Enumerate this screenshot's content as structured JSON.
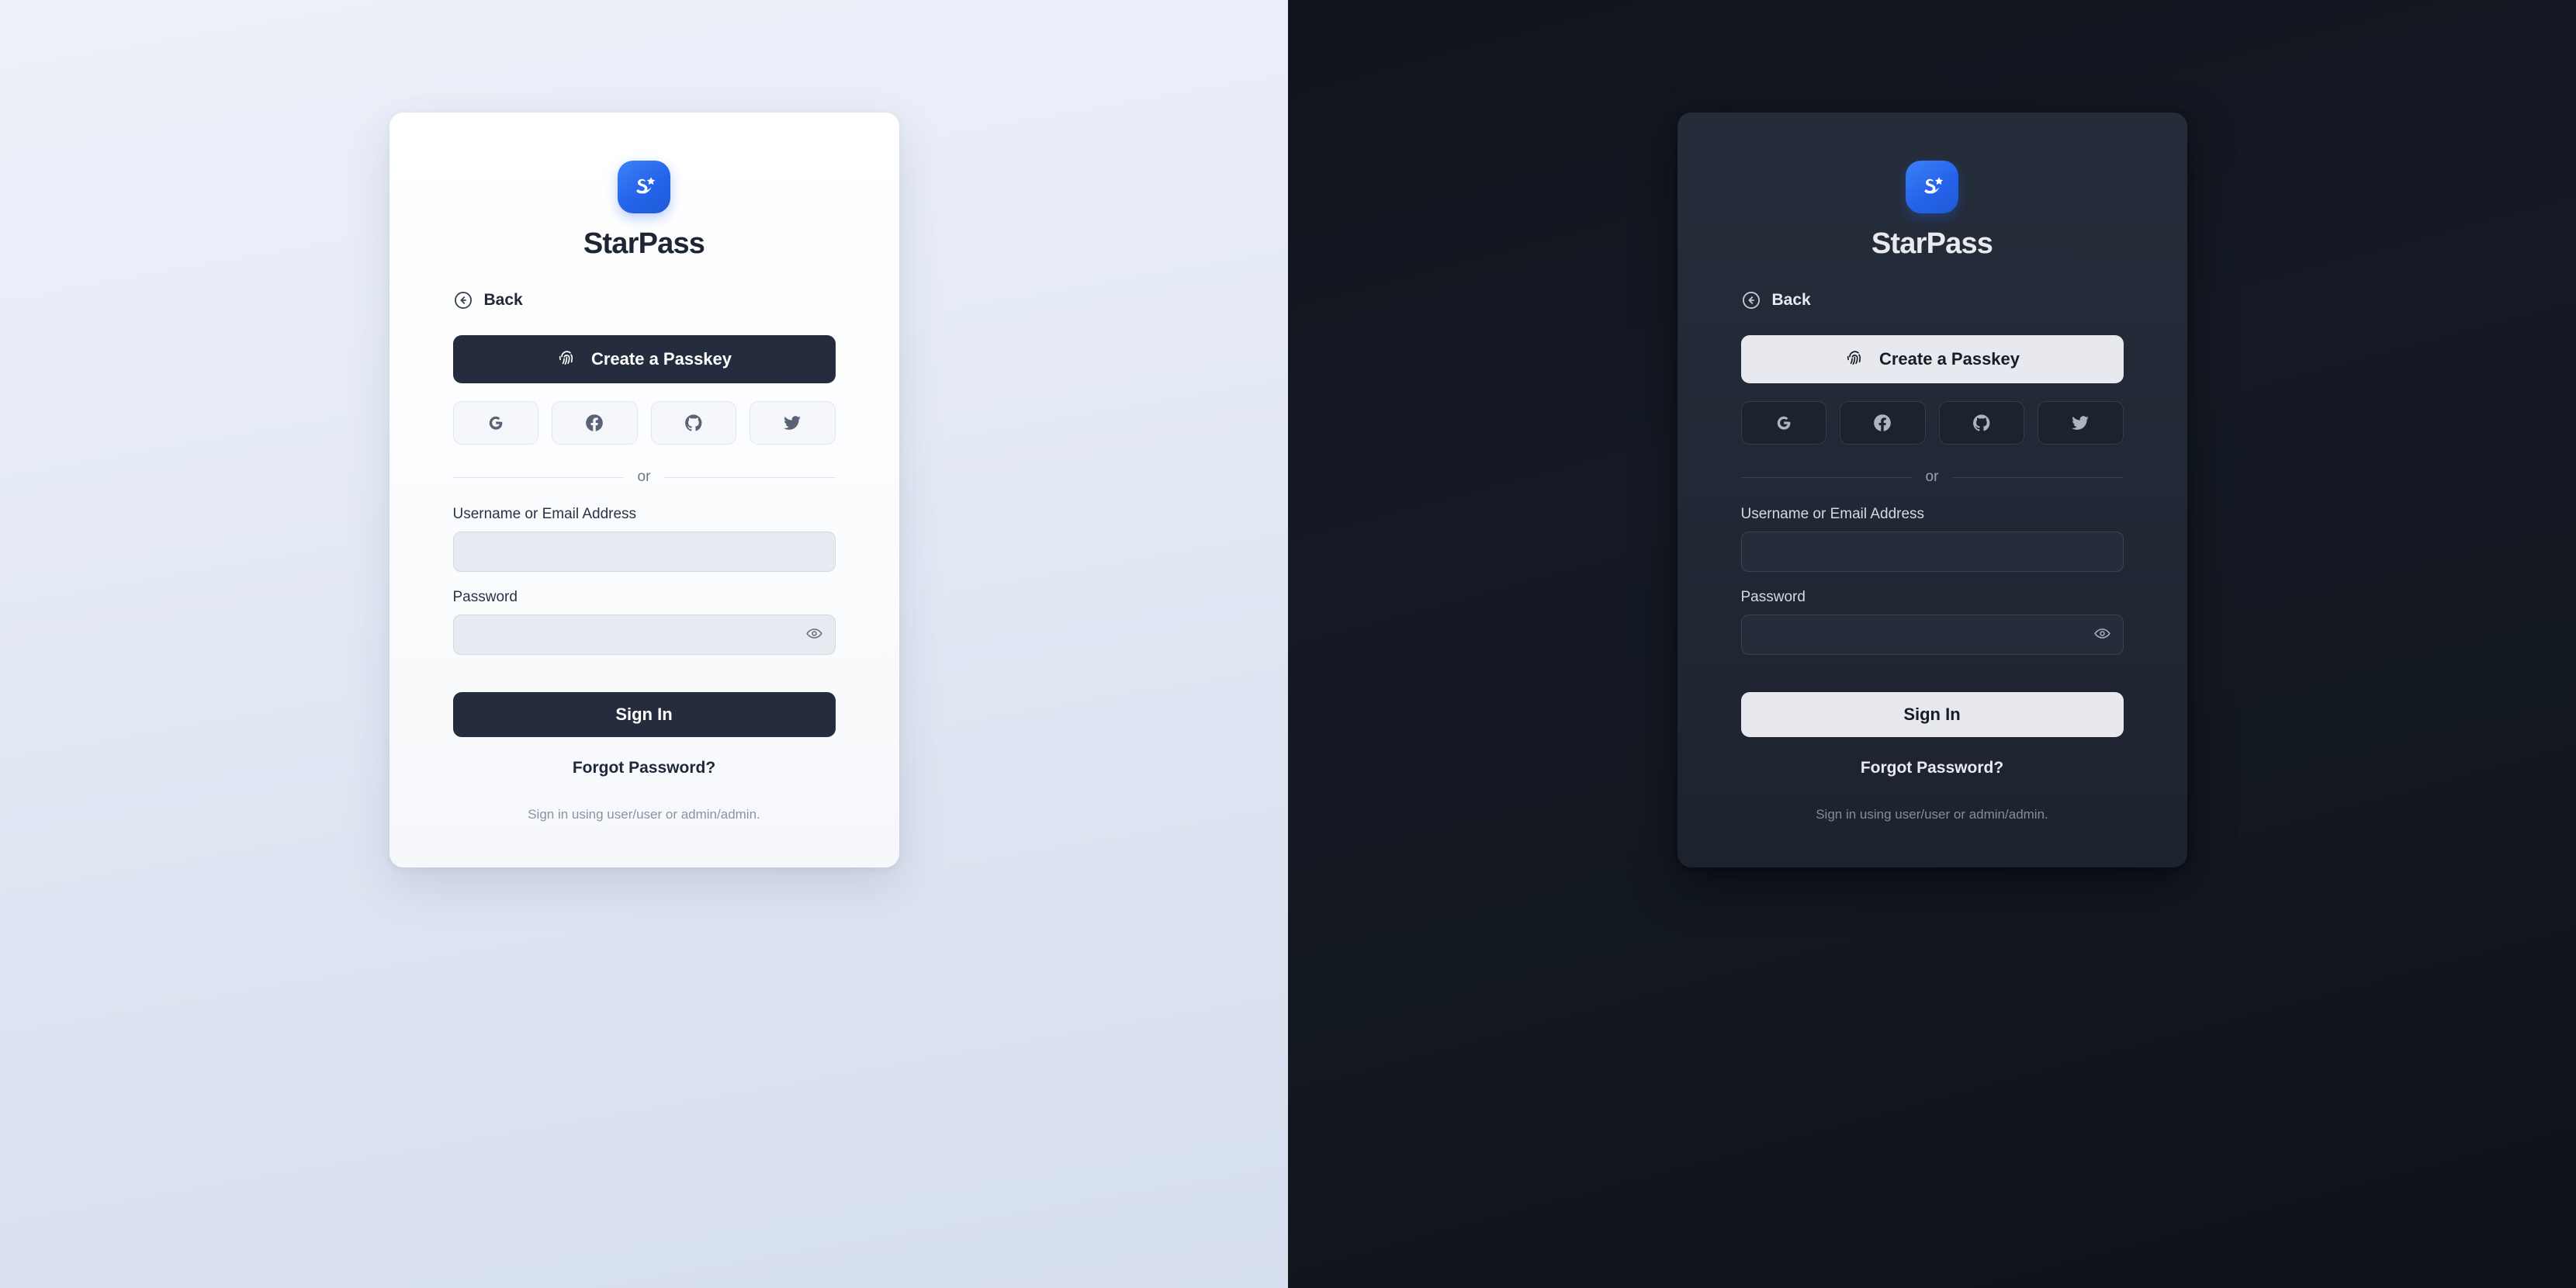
{
  "brand": {
    "name": "StarPass",
    "logo_icon": "starpass-logo-icon",
    "logo_color": "#2563eb"
  },
  "back": {
    "label": "Back",
    "icon": "arrow-left-circle-icon"
  },
  "passkey": {
    "label": "Create a Passkey",
    "icon": "fingerprint-icon"
  },
  "social": [
    {
      "name": "google",
      "icon": "google-icon"
    },
    {
      "name": "facebook",
      "icon": "facebook-icon"
    },
    {
      "name": "github",
      "icon": "github-icon"
    },
    {
      "name": "twitter",
      "icon": "twitter-icon"
    }
  ],
  "divider": {
    "label": "or"
  },
  "form": {
    "username": {
      "label": "Username or Email Address",
      "value": "",
      "placeholder": ""
    },
    "password": {
      "label": "Password",
      "value": "",
      "placeholder": "",
      "reveal_icon": "eye-icon"
    },
    "submit_label": "Sign In"
  },
  "links": {
    "forgot_password": "Forgot Password?"
  },
  "hint": {
    "text": "Sign in using user/user or admin/admin."
  },
  "themes": {
    "light": {
      "name": "light",
      "card_bg": "#ffffff",
      "page_bg": "#e7ecf7",
      "accent": "#242c3d"
    },
    "dark": {
      "name": "dark",
      "card_bg": "#222936",
      "page_bg": "#141924",
      "accent": "#e7e9ee"
    }
  }
}
